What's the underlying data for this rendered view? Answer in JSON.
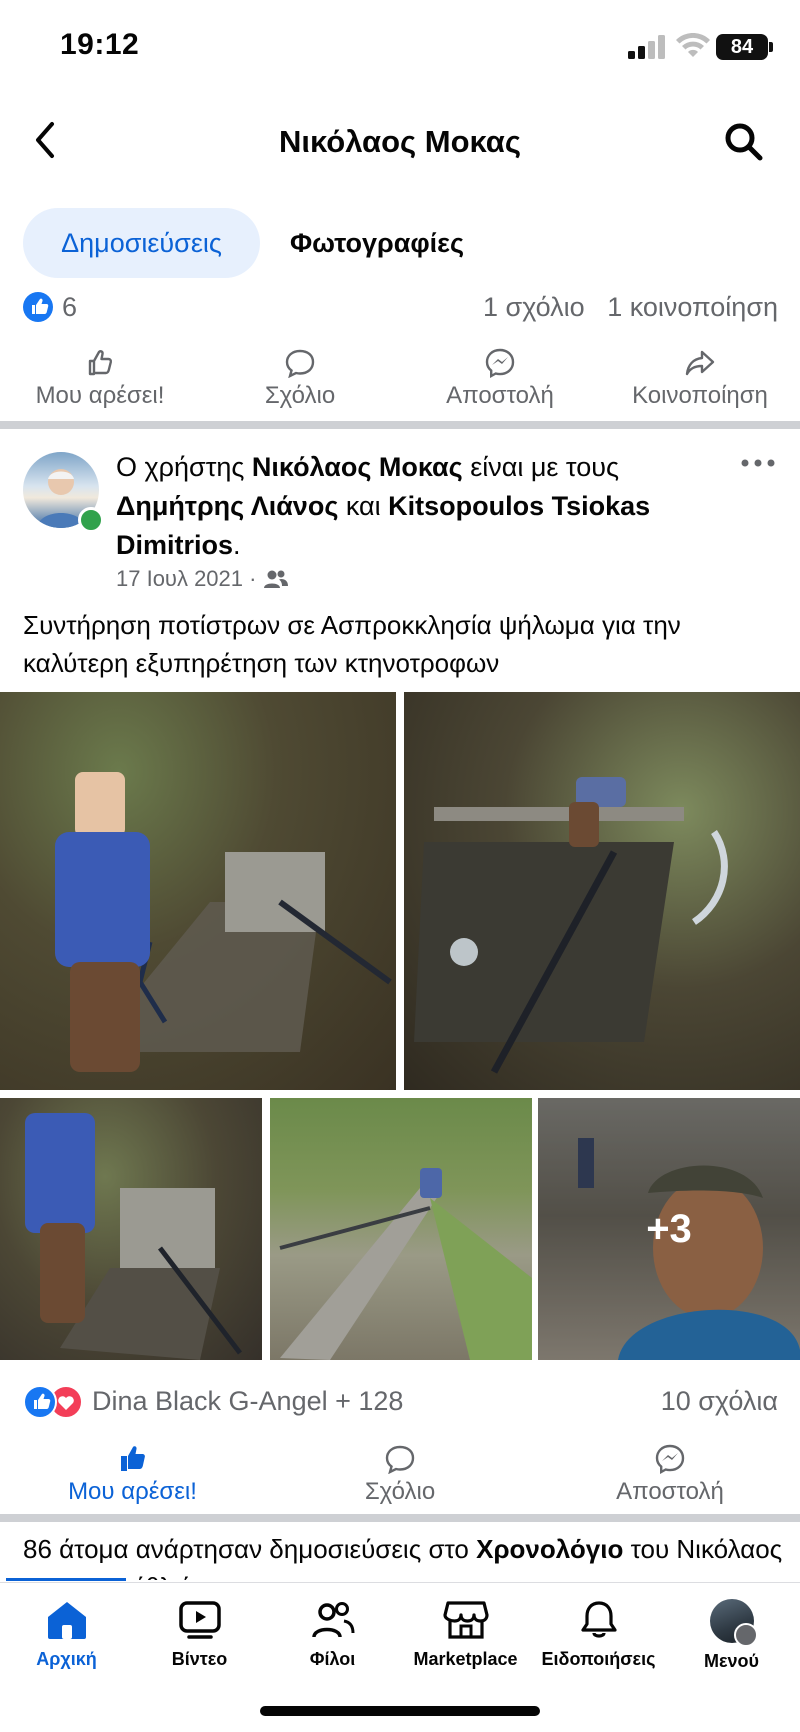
{
  "status_bar": {
    "time": "19:12",
    "battery": "84"
  },
  "header": {
    "title": "Νικόλαος Μοκας"
  },
  "tabs": [
    {
      "label": "Δημοσιεύσεις",
      "active": true
    },
    {
      "label": "Φωτογραφίες",
      "active": false
    }
  ],
  "prev_post": {
    "like_count": "6",
    "comments": "1 σχόλιο",
    "shares": "1 κοινοποίηση",
    "actions": [
      {
        "label": "Μου αρέσει!",
        "icon": "thumbs-up-icon"
      },
      {
        "label": "Σχόλιο",
        "icon": "comment-icon"
      },
      {
        "label": "Αποστολή",
        "icon": "messenger-icon"
      },
      {
        "label": "Κοινοποίηση",
        "icon": "share-icon"
      }
    ]
  },
  "post": {
    "author_prefix": "Ο χρήστης ",
    "author": "Νικόλαος Μοκας",
    "with_text": " είναι με τους ",
    "tagged1": "Δημήτρης Λιάνος",
    "and_text": " και ",
    "tagged2": "Kitsopoulos Tsiokas Dimitrios",
    "end": ".",
    "date": "17 Ιουλ 2021",
    "audience_icon": "friends-icon",
    "text": "Συντήρηση ποτίστρων σε Ασπροκκλησία ψήλωμα για την καλύτερη εξυπηρέτηση των κτηνοτροφων",
    "more_photos": "+3",
    "reactions_names": "Dina Black G-Angel + 128",
    "comments": "10 σχόλια",
    "actions": [
      {
        "label": "Μου αρέσει!",
        "icon": "thumbs-up-filled-icon",
        "active": true
      },
      {
        "label": "Σχόλιο",
        "icon": "comment-icon"
      },
      {
        "label": "Αποστολή",
        "icon": "messenger-icon"
      }
    ]
  },
  "birthday": {
    "prefix": "86 άτομα ανάρτησαν δημοσιεύσεις στο ",
    "bold": "Χρονολόγιο",
    "suffix": " του Νικόλαος για τα γενέθλιά του"
  },
  "bottom_nav": [
    {
      "label": "Αρχική",
      "icon": "home-icon",
      "active": true
    },
    {
      "label": "Βίντεο",
      "icon": "video-icon"
    },
    {
      "label": "Φίλοι",
      "icon": "friends-icon"
    },
    {
      "label": "Marketplace",
      "icon": "marketplace-icon"
    },
    {
      "label": "Ειδοποιήσεις",
      "icon": "bell-icon"
    },
    {
      "label": "Μενού",
      "icon": "profile-avatar"
    }
  ],
  "colors": {
    "accent": "#0b62d6",
    "like": "#1877f2",
    "love": "#f33e58",
    "online": "#31a24c"
  }
}
